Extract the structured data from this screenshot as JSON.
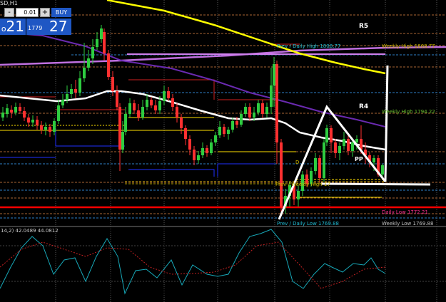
{
  "window": {
    "symbol": "SD,H1"
  },
  "trade_panel": {
    "minus": "-",
    "lot_value": "0.01",
    "plus": "+",
    "buy_label": "BUY",
    "sell_price_big": "21",
    "sell_price_prefix": "o",
    "buy_price_small": "1779",
    "buy_price_big": "27"
  },
  "labels": {
    "r5": "R5",
    "r4": "R4",
    "pp": "PP",
    "weekly_high_1": "Weekly High 1808.77",
    "prev_daily_high": "Prev / Daily High 1808.77",
    "weekly_high_2": "Weekly High 1794.22",
    "prev_daily_low": "Prev / Daily Low 1769.88",
    "weekly_low": "Weekly Low 1769.88",
    "daily_low": "Daily Low 1772.21",
    "small_d": "D",
    "small_prev": "Prev / Weekly High 17"
  },
  "indicator": {
    "label": "14,2) 42.0489 44.0812"
  },
  "colors": {
    "background": "#000000",
    "bull": "#2ecc40",
    "bear": "#ff3030",
    "ma_white": "#ffffff",
    "ma_yellow": "#ffff00",
    "ma_purple": "#7b2fbf",
    "ma_violet": "#c070e0",
    "support_red": "#ff0000"
  }
}
